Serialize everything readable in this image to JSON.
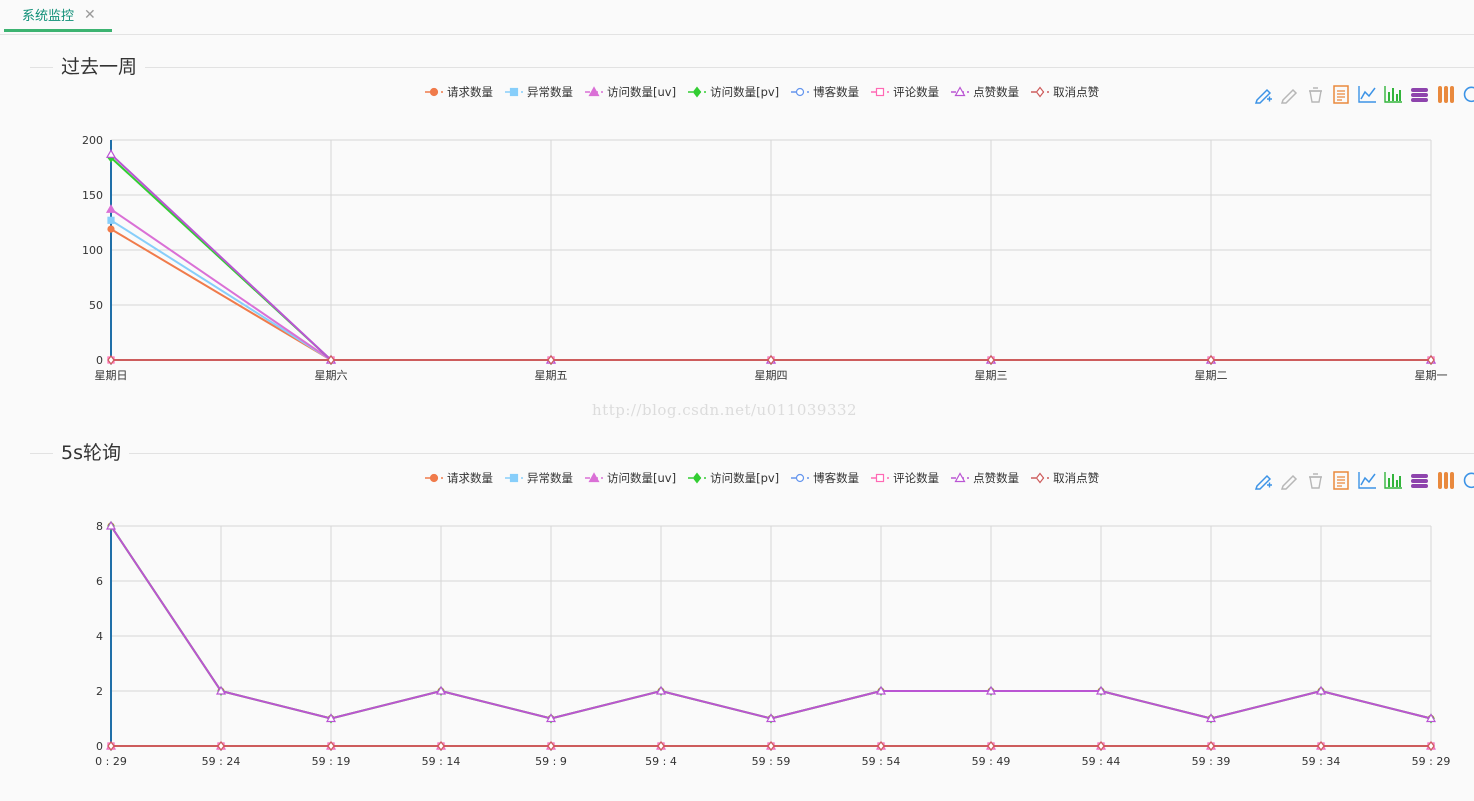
{
  "tab": {
    "label": "系统监控",
    "close_icon": "close-icon"
  },
  "watermark": "http://blog.csdn.net/u011039332",
  "series_colors": {
    "请求数量": "#f07b4b",
    "异常数量": "#87cefa",
    "访问数量[uv]": "#da70d6",
    "访问数量[pv]": "#32cd32",
    "博客数量": "#6495ed",
    "评论数量": "#ff69b4",
    "点赞数量": "#ba55d3",
    "取消点赞": "#cd5c5c"
  },
  "legend": [
    {
      "name": "请求数量",
      "marker": "circle"
    },
    {
      "name": "异常数量",
      "marker": "square"
    },
    {
      "name": "访问数量[uv]",
      "marker": "triangle"
    },
    {
      "name": "访问数量[pv]",
      "marker": "diamond"
    },
    {
      "name": "博客数量",
      "marker": "empty-circle"
    },
    {
      "name": "评论数量",
      "marker": "empty-square"
    },
    {
      "name": "点赞数量",
      "marker": "empty-triangle"
    },
    {
      "name": "取消点赞",
      "marker": "empty-diamond"
    }
  ],
  "toolbox_icons": [
    "mark-pen-icon",
    "mark-undo-icon",
    "mark-clear-icon",
    "data-view-icon",
    "line-chart-icon",
    "bar-chart-icon",
    "stack-icon",
    "tiled-icon",
    "restore-icon"
  ],
  "chart_data": [
    {
      "type": "line",
      "title": "过去一周",
      "categories": [
        "星期日",
        "星期六",
        "星期五",
        "星期四",
        "星期三",
        "星期二",
        "星期一"
      ],
      "ylim": [
        0,
        200
      ],
      "yticks": [
        0,
        50,
        100,
        150,
        200
      ],
      "grid": true,
      "legend_position": "top-center",
      "series": [
        {
          "name": "请求数量",
          "values": [
            119,
            0,
            0,
            0,
            0,
            0,
            0
          ]
        },
        {
          "name": "异常数量",
          "values": [
            127,
            0,
            0,
            0,
            0,
            0,
            0
          ]
        },
        {
          "name": "访问数量[uv]",
          "values": [
            137,
            0,
            0,
            0,
            0,
            0,
            0
          ]
        },
        {
          "name": "访问数量[pv]",
          "values": [
            184,
            0,
            0,
            0,
            0,
            0,
            0
          ]
        },
        {
          "name": "博客数量",
          "values": [
            0,
            0,
            0,
            0,
            0,
            0,
            0
          ]
        },
        {
          "name": "评论数量",
          "values": [
            0,
            0,
            0,
            0,
            0,
            0,
            0
          ]
        },
        {
          "name": "点赞数量",
          "values": [
            187,
            0,
            0,
            0,
            0,
            0,
            0
          ]
        },
        {
          "name": "取消点赞",
          "values": [
            0,
            0,
            0,
            0,
            0,
            0,
            0
          ]
        }
      ]
    },
    {
      "type": "line",
      "title": "5s轮询",
      "categories": [
        "0 : 29",
        "59 : 24",
        "59 : 19",
        "59 : 14",
        "59 : 9",
        "59 : 4",
        "59 : 59",
        "59 : 54",
        "59 : 49",
        "59 : 44",
        "59 : 39",
        "59 : 34",
        "59 : 29"
      ],
      "ylim": [
        0,
        8
      ],
      "yticks": [
        0,
        2,
        4,
        6,
        8
      ],
      "grid": true,
      "legend_position": "top-center",
      "series": [
        {
          "name": "请求数量",
          "values": [
            8,
            2,
            1,
            2,
            1,
            2,
            1,
            2,
            2,
            2,
            1,
            2,
            1
          ]
        },
        {
          "name": "访问数量[pv]",
          "values": [
            8,
            2,
            1,
            2,
            1,
            2,
            1,
            2,
            2,
            2,
            1,
            2,
            1
          ]
        },
        {
          "name": "点赞数量",
          "values": [
            8,
            2,
            1,
            2,
            1,
            2,
            1,
            2,
            2,
            2,
            1,
            2,
            1
          ]
        },
        {
          "name": "异常数量",
          "values": [
            0,
            0,
            0,
            0,
            0,
            0,
            0,
            0,
            0,
            0,
            0,
            0,
            0
          ]
        },
        {
          "name": "访问数量[uv]",
          "values": [
            0,
            0,
            0,
            0,
            0,
            0,
            0,
            0,
            0,
            0,
            0,
            0,
            0
          ]
        },
        {
          "name": "博客数量",
          "values": [
            0,
            0,
            0,
            0,
            0,
            0,
            0,
            0,
            0,
            0,
            0,
            0,
            0
          ]
        },
        {
          "name": "评论数量",
          "values": [
            0,
            0,
            0,
            0,
            0,
            0,
            0,
            0,
            0,
            0,
            0,
            0,
            0
          ]
        },
        {
          "name": "取消点赞",
          "values": [
            0,
            0,
            0,
            0,
            0,
            0,
            0,
            0,
            0,
            0,
            0,
            0,
            0
          ]
        }
      ]
    }
  ]
}
